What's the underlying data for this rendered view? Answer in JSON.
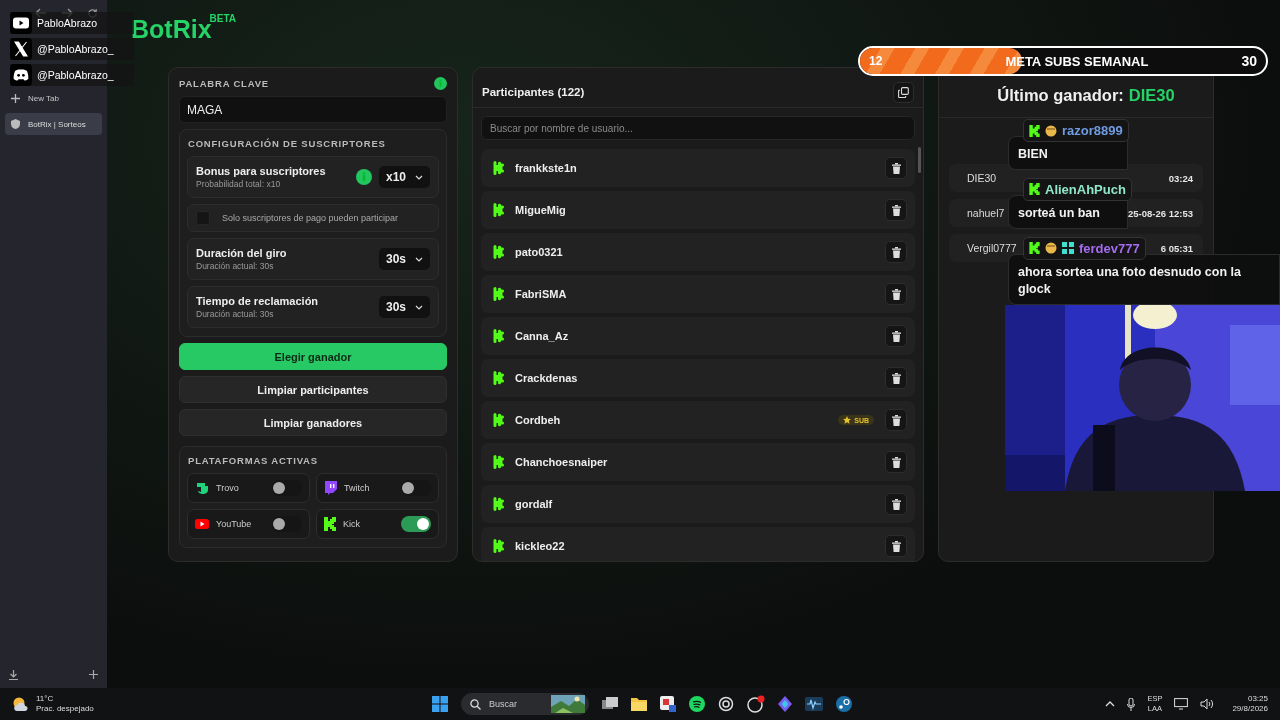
{
  "browser": {
    "tabs": [
      {
        "kind": "new",
        "label": "New Tab",
        "selected": false
      },
      {
        "kind": "page",
        "label": "BotRix | Sorteos",
        "selected": true
      }
    ]
  },
  "socials": [
    {
      "kind": "youtube",
      "handle": "PabloAbrazo"
    },
    {
      "kind": "x",
      "handle": "@PabloAbrazo_"
    },
    {
      "kind": "discord",
      "handle": "@PabloAbrazo_"
    }
  ],
  "app": {
    "logo": "BotRix",
    "badge": "BETA"
  },
  "keyword": {
    "label": "PALABRA CLAVE",
    "value": "MAGA"
  },
  "subscribers": {
    "title": "CONFIGURACIÓN DE SUSCRIPTORES",
    "settings": [
      {
        "kind": "select",
        "title": "Bonus para suscriptores",
        "subtitle": "Probabilidad total: x10",
        "info": true,
        "value": "x10"
      },
      {
        "kind": "checkbox",
        "label": "Solo suscriptores de pago pueden participar",
        "checked": false
      },
      {
        "kind": "select",
        "title": "Duración del giro",
        "subtitle": "Duración actual: 30s",
        "info": false,
        "value": "30s"
      },
      {
        "kind": "select",
        "title": "Tiempo de reclamación",
        "subtitle": "Duración actual: 30s",
        "info": false,
        "value": "30s"
      }
    ]
  },
  "actions": [
    {
      "kind": "primary",
      "label": "Elegir ganador"
    },
    {
      "kind": "secondary",
      "label": "Limpiar participantes"
    },
    {
      "kind": "secondary",
      "label": "Limpiar ganadores"
    }
  ],
  "platforms": {
    "title": "PLATAFORMAS ACTIVAS",
    "items": [
      {
        "kind": "trovo",
        "name": "Trovo",
        "on": false
      },
      {
        "kind": "twitch",
        "name": "Twitch",
        "on": false
      },
      {
        "kind": "youtube",
        "name": "YouTube",
        "on": false
      },
      {
        "kind": "kick",
        "name": "Kick",
        "on": true
      }
    ]
  },
  "participants": {
    "title": "Participantes (122)",
    "placeholder": "Buscar por nombre de usuario...",
    "rows": [
      {
        "name": "frankkste1n"
      },
      {
        "name": "MigueMig"
      },
      {
        "name": "pato0321"
      },
      {
        "name": "FabriSMA"
      },
      {
        "name": "Canna_Az"
      },
      {
        "name": "Crackdenas"
      },
      {
        "name": "Cordbeh",
        "badge": "SUB"
      },
      {
        "name": "Chanchoesnaiper"
      },
      {
        "name": "gordalf"
      },
      {
        "name": "kickleo22"
      }
    ]
  },
  "winners": {
    "label": "Último ganador:",
    "name": "DIE30",
    "rows": [
      {
        "name": "DIE30",
        "time": "03:24"
      },
      {
        "name": "nahuel7",
        "time": "25-08-26 12:53"
      },
      {
        "name": "Vergil0777",
        "time": "6 05:31"
      }
    ]
  },
  "subs_goal": {
    "current": "12",
    "title": "META SUBS SEMANAL",
    "target": "30",
    "level": 0.4
  },
  "chat": [
    {
      "user": "razor8899",
      "color": "#6f9be0",
      "badges": [
        {
          "kind": "kick"
        },
        {
          "kind": "emote"
        }
      ],
      "text": "BIEN"
    },
    {
      "user": "AlienAhPuch",
      "color": "#8fe6c9",
      "badges": [
        {
          "kind": "kick"
        }
      ],
      "text": "sorteá un ban"
    },
    {
      "user": "ferdev777",
      "color": "#a66cf0",
      "badges": [
        {
          "kind": "kick"
        },
        {
          "kind": "emote"
        },
        {
          "kind": "grid"
        }
      ],
      "text": "ahora sortea una foto desnudo con la glock"
    }
  ],
  "taskbar": {
    "temperature": "11°C",
    "weather": "Prac. despejado",
    "placeholder": "Buscar",
    "language": "ESP",
    "layout": "LAA",
    "time": "03:25",
    "date": "29/8/2026"
  }
}
